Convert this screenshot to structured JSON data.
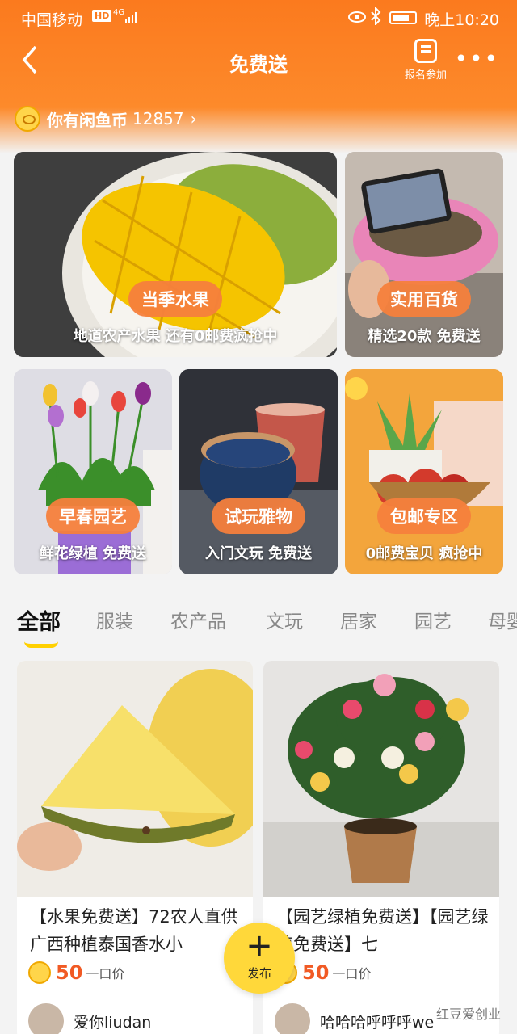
{
  "status": {
    "carrier": "中国移动",
    "hd": "HD",
    "network": "4G",
    "time": "晚上10:20"
  },
  "nav": {
    "back_icon": "chevron-left-icon",
    "title": "免费送",
    "signup_label": "报名参加",
    "more_icon": "more-dots-icon"
  },
  "coins": {
    "label": "你有闲鱼币",
    "amount": "12857",
    "chevron": "›"
  },
  "promo_cards": [
    {
      "pill": "当季水果",
      "subtitle": "地道农产水果 还有0邮费疯抢中"
    },
    {
      "pill": "实用百货",
      "subtitle": "精选20款 免费送"
    },
    {
      "pill": "早春园艺",
      "subtitle": "鲜花绿植 免费送"
    },
    {
      "pill": "试玩雅物",
      "subtitle": "入门文玩 免费送"
    },
    {
      "pill": "包邮专区",
      "subtitle": "0邮费宝贝 疯抢中"
    }
  ],
  "tabs": [
    "全部",
    "服装",
    "农产品",
    "文玩",
    "居家",
    "园艺",
    "母婴"
  ],
  "products": [
    {
      "title": "【水果免费送】72农人直供广西种植泰国香水小",
      "price": "50",
      "price_unit": "一口价",
      "user": "爱你liudan"
    },
    {
      "title": "【园艺绿植免费送】【园艺绿植免费送】七",
      "price": "50",
      "price_unit": "一口价",
      "user": "哈哈哈呼呼呼we"
    }
  ],
  "publish": {
    "plus": "+",
    "label": "发布"
  },
  "watermark": "红豆爱创业",
  "colors": {
    "brand_orange": "#fb7a1e",
    "price": "#f15a24",
    "accent_yellow": "#ffd83a"
  }
}
